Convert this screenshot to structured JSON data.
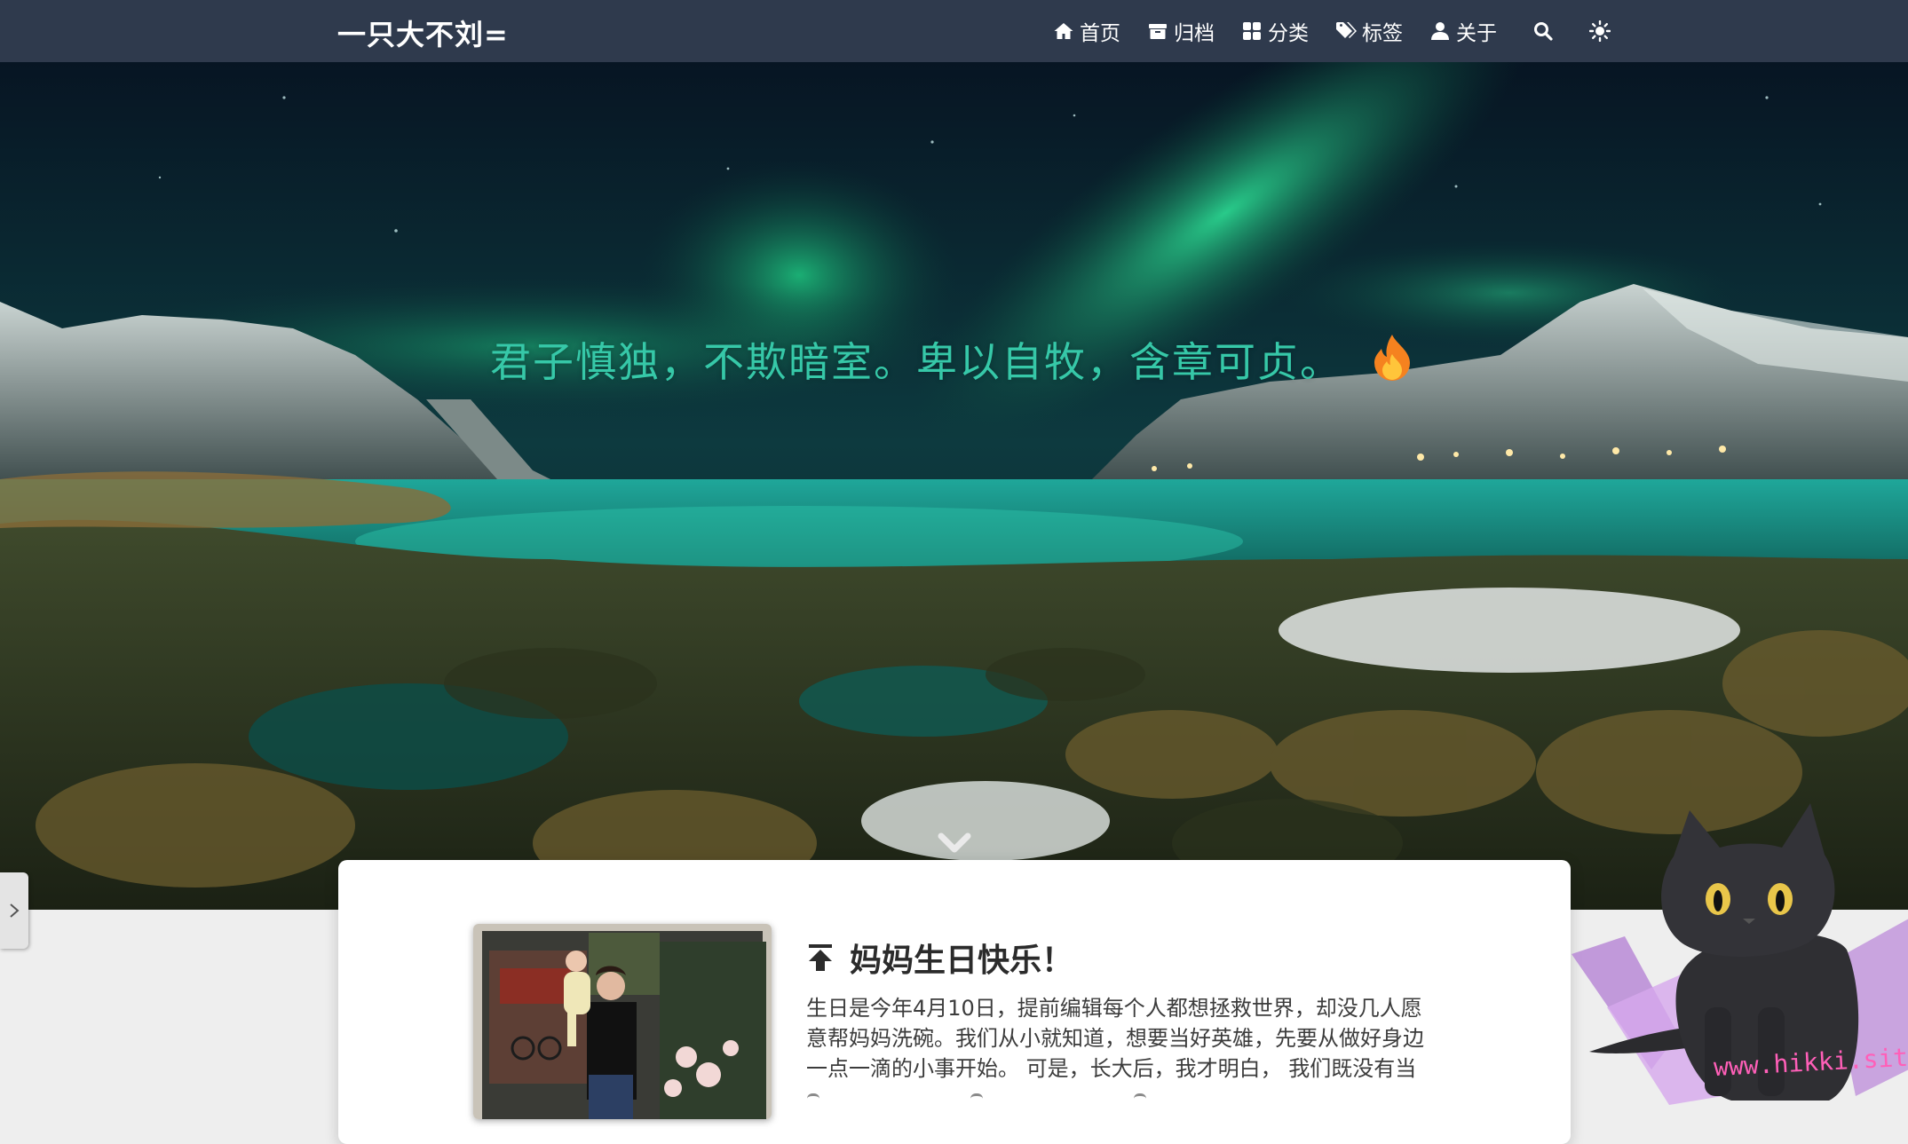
{
  "site": {
    "brand": "一只大不刘="
  },
  "nav": {
    "items": [
      {
        "label": "首页",
        "icon": "home-icon"
      },
      {
        "label": "归档",
        "icon": "archive-icon"
      },
      {
        "label": "分类",
        "icon": "category-icon"
      },
      {
        "label": "标签",
        "icon": "tags-icon"
      },
      {
        "label": "关于",
        "icon": "user-icon"
      }
    ],
    "search_icon": "search-icon",
    "theme_icon": "sun-icon"
  },
  "hero": {
    "slogan": "君子慎独，不欺暗室。卑以自牧，含章可贞。",
    "emoji": "flame-icon",
    "scroll_icon": "chevron-down-icon"
  },
  "post": {
    "pinned_icon": "pin-top-icon",
    "title": "妈妈生日快乐！",
    "excerpt_lines": [
      "生日是今年4月10日，提前编辑每个人都想拯救世界，却没几人愿",
      "意帮妈妈洗碗。我们从小就知道，想要当好英雄，先要从做好身边",
      "一点一滴的小事开始。 可是，长大后，我才明白， 我们既没有当"
    ]
  },
  "mascot": {
    "watermark": "www.hikki.site"
  },
  "colors": {
    "navbar": "#2f3a4d",
    "slogan": "#36c8a8",
    "card": "#ffffff",
    "page_bg": "#eeeeee"
  }
}
